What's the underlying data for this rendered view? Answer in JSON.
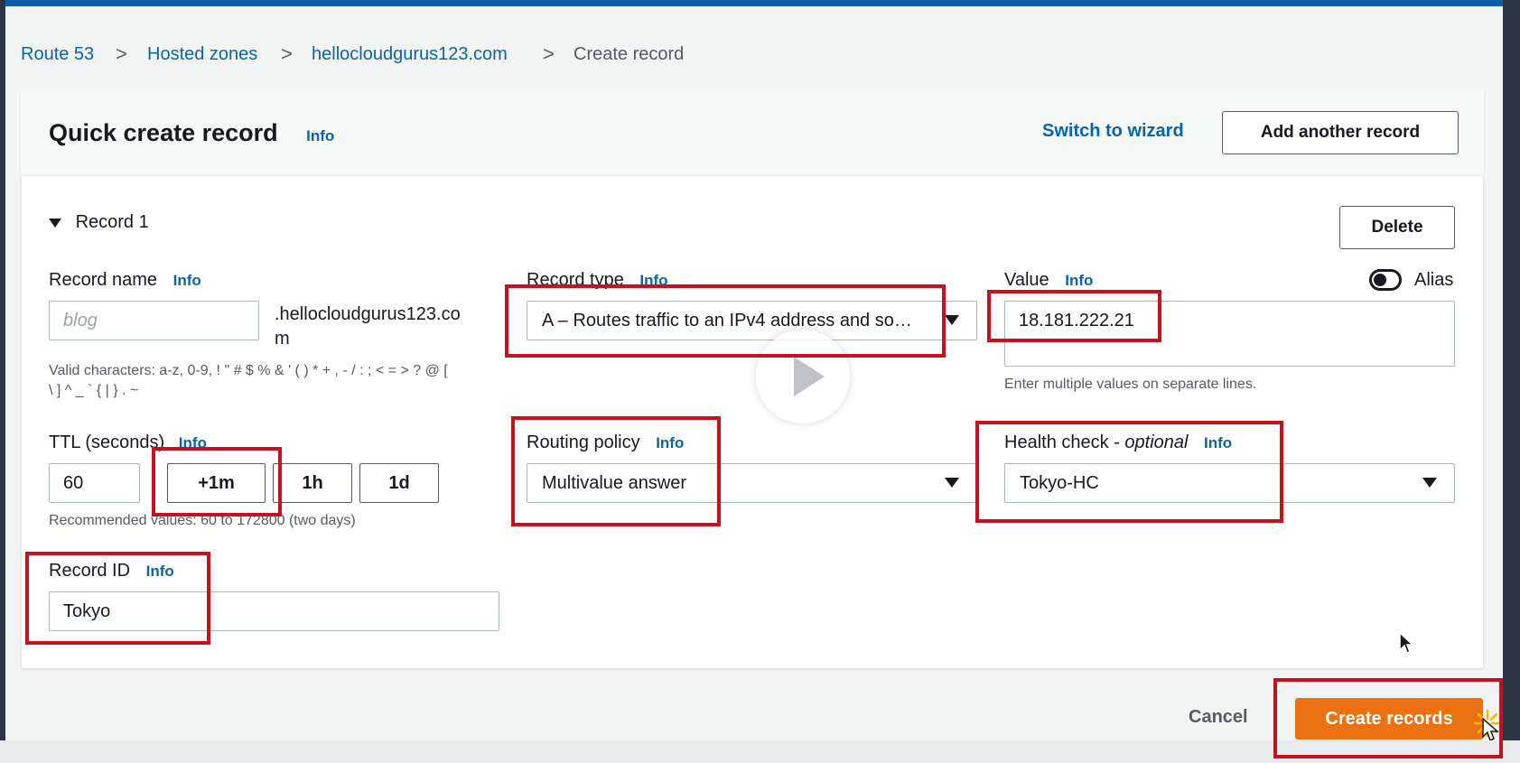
{
  "breadcrumb": {
    "items": [
      "Route 53",
      "Hosted zones",
      "hellocloudgurus123.com"
    ],
    "current": "Create record",
    "separator": ">"
  },
  "header": {
    "title": "Quick create record",
    "info": "Info",
    "switch_link": "Switch to wizard",
    "add_button": "Add another record"
  },
  "record": {
    "section_label": "Record 1",
    "delete_button": "Delete",
    "name": {
      "label": "Record name",
      "info": "Info",
      "placeholder": "blog",
      "suffix_line1": ".hellocloudgurus123.co",
      "suffix_line2": "m",
      "hint_line1": "Valid characters: a-z, 0-9, ! \" # $ % & ' ( ) * + , - / : ; < = > ? @ [",
      "hint_line2": "\\ ] ^ _ ` { | } . ~"
    },
    "type": {
      "label": "Record type",
      "info": "Info",
      "value": "A – Routes traffic to an IPv4 address and so…"
    },
    "value": {
      "label": "Value",
      "info": "Info",
      "text": "18.181.222.21",
      "hint": "Enter multiple values on separate lines.",
      "alias_label": "Alias"
    },
    "ttl": {
      "label": "TTL (seconds)",
      "info": "Info",
      "value": "60",
      "buttons": [
        "+1m",
        "1h",
        "1d"
      ],
      "hint": "Recommended values: 60 to 172800 (two days)"
    },
    "routing": {
      "label": "Routing policy",
      "info": "Info",
      "value": "Multivalue answer"
    },
    "health": {
      "label": "Health check - ",
      "label_italic": "optional",
      "info": "Info",
      "value": "Tokyo-HC"
    },
    "record_id": {
      "label": "Record ID",
      "info": "Info",
      "value": "Tokyo"
    }
  },
  "footer": {
    "cancel": "Cancel",
    "create": "Create records"
  },
  "colors": {
    "accent": "#0a64a8",
    "primary": "#ec7211",
    "highlight": "#c4131e"
  }
}
